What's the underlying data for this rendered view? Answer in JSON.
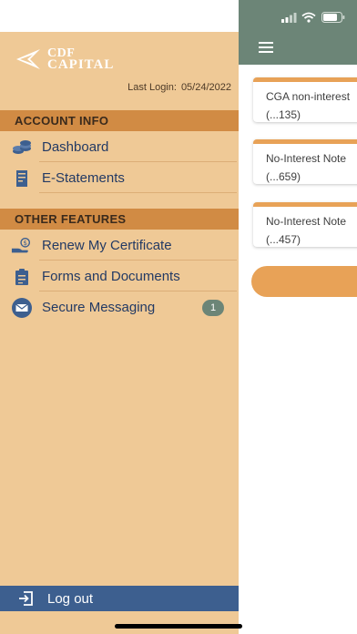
{
  "drawer": {
    "logo": {
      "line1": "CDF",
      "line2": "CAPITAL"
    },
    "last_login": {
      "label": "Last Login:",
      "date": "05/24/2022"
    },
    "sections": [
      {
        "header": "ACCOUNT INFO",
        "items": [
          {
            "label": "Dashboard",
            "icon": "coins-icon"
          },
          {
            "label": "E-Statements",
            "icon": "statement-icon"
          }
        ]
      },
      {
        "header": "OTHER FEATURES",
        "items": [
          {
            "label": "Renew My Certificate",
            "icon": "hand-money-icon"
          },
          {
            "label": "Forms and Documents",
            "icon": "clipboard-icon"
          },
          {
            "label": "Secure Messaging",
            "icon": "envelope-icon",
            "badge": "1"
          }
        ]
      }
    ],
    "logout": {
      "label": "Log out",
      "icon": "logout-icon"
    }
  },
  "main": {
    "accounts": [
      {
        "name": "CGA non-interest",
        "number": "(...135)"
      },
      {
        "name": "No-Interest Note",
        "number": "(...659)"
      },
      {
        "name": "No-Interest Note",
        "number": "(...457)"
      }
    ]
  },
  "colors": {
    "drawer_bg": "#efc996",
    "section_header": "#d18b44",
    "menu_text": "#233a64",
    "logout_bar": "#3d5f8f",
    "header_green": "#6c8577",
    "accent_orange": "#e8a257"
  }
}
